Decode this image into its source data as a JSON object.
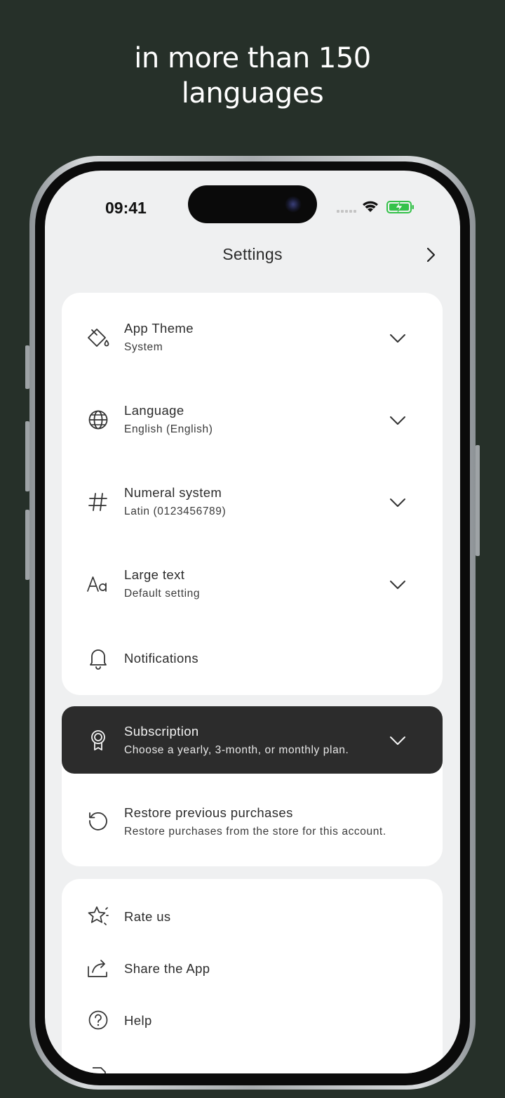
{
  "headline": {
    "line1": "in more than 150",
    "line2": "languages"
  },
  "status_bar": {
    "time": "09:41",
    "battery": "charging",
    "signal": "wifi"
  },
  "nav": {
    "title": "Settings"
  },
  "settings": {
    "app_theme": {
      "title": "App Theme",
      "value": "System"
    },
    "language": {
      "title": "Language",
      "value": "English (English)"
    },
    "numeral_system": {
      "title": "Numeral system",
      "value": "Latin (0123456789)"
    },
    "large_text": {
      "title": "Large text",
      "value": "Default setting"
    },
    "notifications": {
      "title": "Notifications"
    }
  },
  "subscription": {
    "title": "Subscription",
    "description": "Choose a yearly, 3-month, or monthly plan."
  },
  "restore": {
    "title": "Restore previous purchases",
    "description": "Restore purchases from the store for this account."
  },
  "more": {
    "rate": "Rate us",
    "share": "Share the App",
    "help": "Help"
  },
  "colors": {
    "background": "#263029",
    "screen": "#eff0f1",
    "card": "#ffffff",
    "selected_row": "#2c2c2c",
    "battery": "#35c24a"
  },
  "icons": [
    "paint-bucket-icon",
    "globe-icon",
    "hash-icon",
    "text-size-icon",
    "bell-icon",
    "award-icon",
    "restore-icon",
    "star-icon",
    "share-icon",
    "help-icon",
    "chevron-down-icon",
    "chevron-right-icon"
  ]
}
